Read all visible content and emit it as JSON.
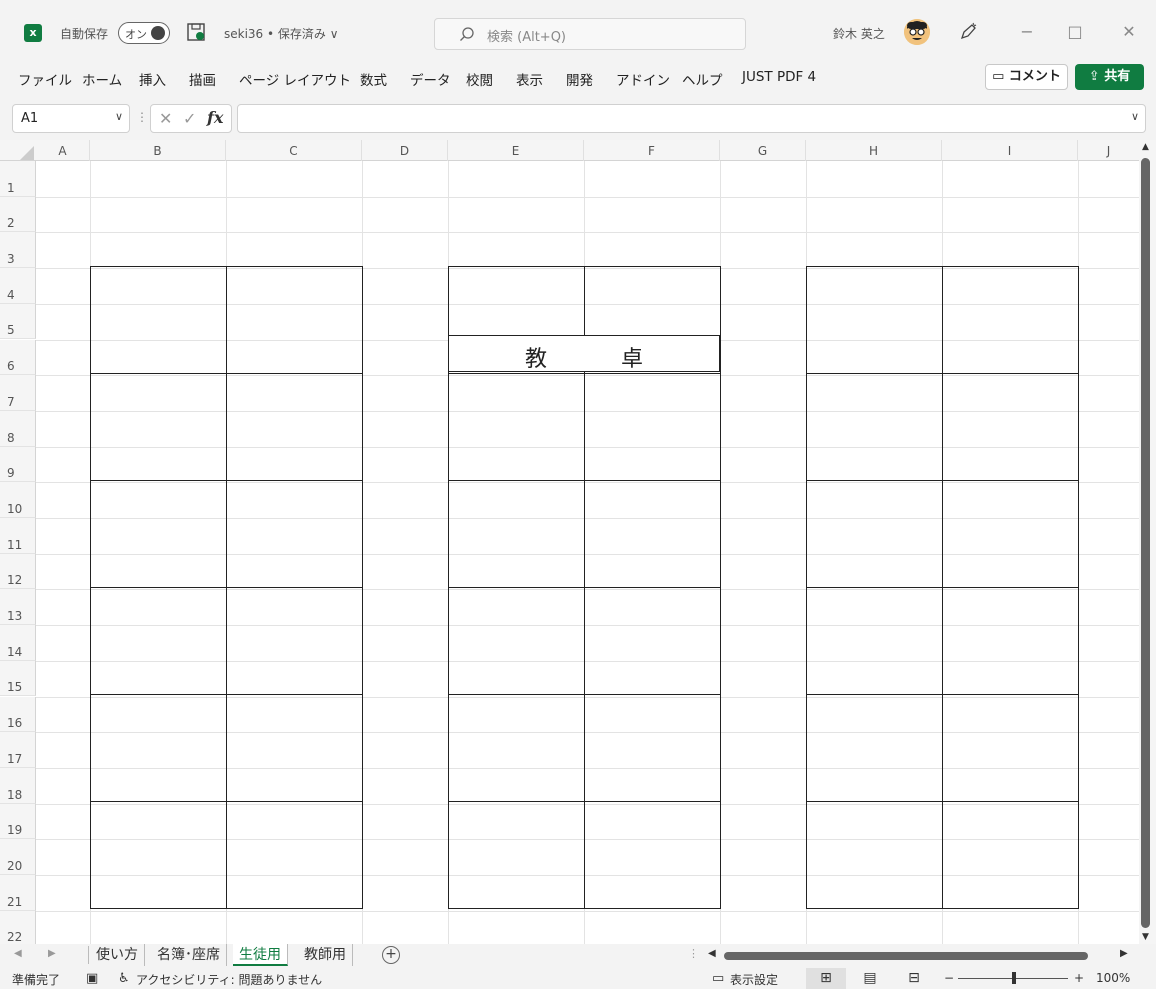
{
  "titlebar": {
    "app_icon": "excel-icon",
    "autosave_label": "自動保存",
    "autosave_state": "オン",
    "file_title": "seki36 • 保存済み ∨",
    "search_placeholder": "検索 (Alt+Q)",
    "user_name": "鈴木 英之",
    "minimize": "−",
    "maximize": "□",
    "close": "✕"
  },
  "menu": {
    "items": [
      "ファイル",
      "ホーム",
      "挿入",
      "描画",
      "ページ レイアウト",
      "数式",
      "データ",
      "校閲",
      "表示",
      "開発",
      "アドイン",
      "ヘルプ",
      "JUST PDF 4"
    ],
    "comment_label": "コメント",
    "share_label": "共有"
  },
  "formula_bar": {
    "name_box": "A1",
    "cancel": "✕",
    "enter": "✓",
    "fx": "fx",
    "formula": ""
  },
  "grid": {
    "columns": [
      "A",
      "B",
      "C",
      "D",
      "E",
      "F",
      "G",
      "H",
      "I",
      "J"
    ],
    "rows": [
      "1",
      "2",
      "3",
      "4",
      "5",
      "6",
      "7",
      "8",
      "9",
      "10",
      "11",
      "12",
      "13",
      "14",
      "15",
      "16",
      "17",
      "18",
      "19",
      "20",
      "21",
      "22"
    ],
    "cells": {
      "E2_char1": "教",
      "E2_char2": "卓"
    }
  },
  "sheet_tabs": {
    "tabs": [
      "使い方",
      "名簿･座席",
      "生徒用",
      "教師用"
    ],
    "active": "生徒用",
    "add": "+"
  },
  "statusbar": {
    "ready": "準備完了",
    "accessibility": "アクセシビリティ: 問題ありません",
    "display_settings": "表示設定",
    "zoom": "100%",
    "zoom_minus": "−",
    "zoom_plus": "+"
  },
  "colors": {
    "accent": "#107c41",
    "border": "#222222"
  }
}
